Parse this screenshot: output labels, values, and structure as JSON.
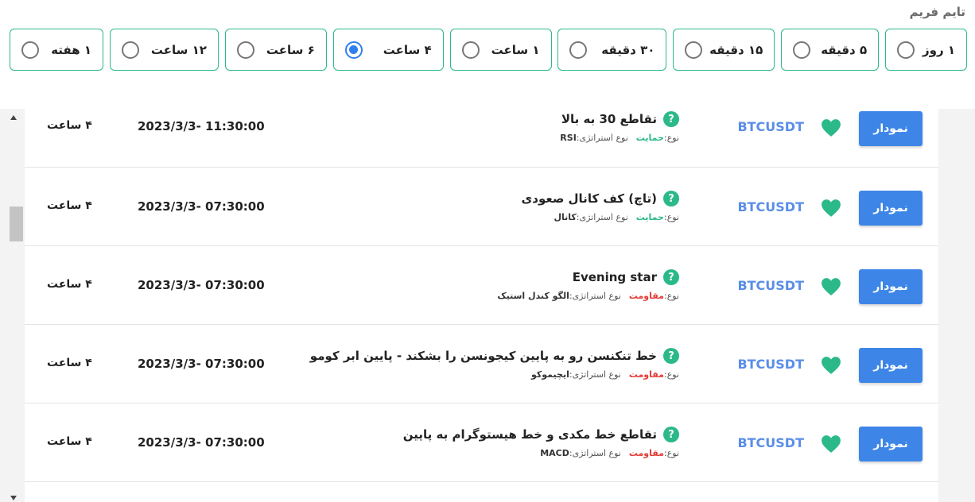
{
  "timeframe": {
    "title": "تایم فریم",
    "options": [
      {
        "label": "۱ روز",
        "checked": false
      },
      {
        "label": "۵ دقیقه",
        "checked": false
      },
      {
        "label": "۱۵ دقیقه",
        "checked": false
      },
      {
        "label": "۳۰ دقیقه",
        "checked": false
      },
      {
        "label": "۱ ساعت",
        "checked": false
      },
      {
        "label": "۴ ساعت",
        "checked": true
      },
      {
        "label": "۶ ساعت",
        "checked": false
      },
      {
        "label": "۱۲ ساعت",
        "checked": false
      },
      {
        "label": "۱ هفته",
        "checked": false
      }
    ]
  },
  "strategy_label": "نوع استراتژی:",
  "type_label": "نوع:",
  "chart_button_label": "نمودار",
  "help_icon_glyph": "?",
  "colors": {
    "accent_green": "#2bb98a",
    "button_blue": "#3d86e8",
    "symbol_blue": "#5a8ee8",
    "resistance_red": "#e53935"
  },
  "signals": [
    {
      "symbol": "BTCUSDT",
      "title": "تقاطع 30 به بالا",
      "strategy": "RSI",
      "type": "حمایت",
      "type_color": "green",
      "datetime": "2023/3/3- 11:30:00",
      "timeframe": "۴ ساعت"
    },
    {
      "symbol": "BTCUSDT",
      "title": "(تاچ) کف کانال صعودی",
      "strategy": "کانال",
      "type": "حمایت",
      "type_color": "green",
      "datetime": "2023/3/3- 07:30:00",
      "timeframe": "۴ ساعت"
    },
    {
      "symbol": "BTCUSDT",
      "title": "Evening star",
      "strategy": "الگو کندل استیک",
      "type": "مقاومت",
      "type_color": "red",
      "datetime": "2023/3/3- 07:30:00",
      "timeframe": "۴ ساعت"
    },
    {
      "symbol": "BTCUSDT",
      "title": "خط تنکنسن رو به پایین کیجونسن را بشکند - پایین ابر کومو",
      "strategy": "ایچیموکو",
      "type": "مقاومت",
      "type_color": "red",
      "datetime": "2023/3/3- 07:30:00",
      "timeframe": "۴ ساعت"
    },
    {
      "symbol": "BTCUSDT",
      "title": "تقاطع خط مکدی و خط هیستوگرام به پایین",
      "strategy": "MACD",
      "type": "مقاومت",
      "type_color": "red",
      "datetime": "2023/3/3- 07:30:00",
      "timeframe": "۴ ساعت"
    }
  ]
}
